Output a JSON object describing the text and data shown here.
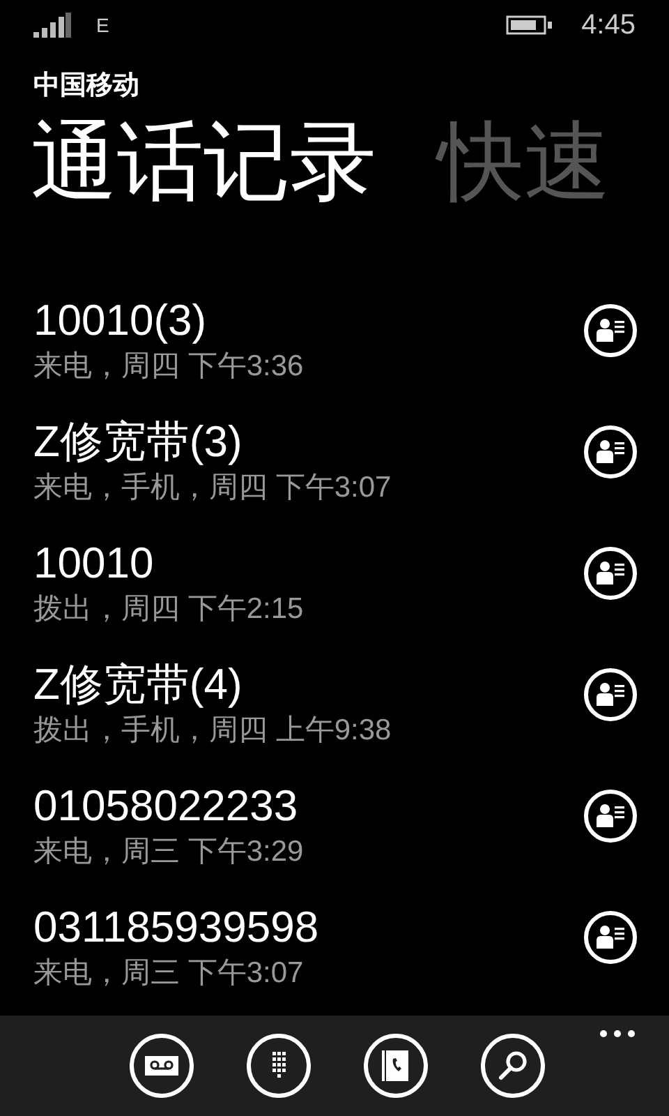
{
  "status_bar": {
    "network": "E",
    "time": "4:45"
  },
  "carrier": "中国移动",
  "pivots": [
    {
      "label": "通话记录",
      "selected": true
    },
    {
      "label": "快速",
      "selected": false
    }
  ],
  "calls": [
    {
      "name": "10010(3)",
      "detail": "来电，周四 下午3:36"
    },
    {
      "name": "Z修宽带(3)",
      "detail": "来电，手机，周四 下午3:07"
    },
    {
      "name": "10010",
      "detail": "拨出，周四 下午2:15"
    },
    {
      "name": "Z修宽带(4)",
      "detail": "拨出，手机，周四 上午9:38"
    },
    {
      "name": "01058022233",
      "detail": "来电，周三 下午3:29"
    },
    {
      "name": "031185939598",
      "detail": "来电，周三 下午3:07"
    }
  ],
  "app_bar": {
    "buttons": [
      {
        "kind": "voicemail"
      },
      {
        "kind": "keypad"
      },
      {
        "kind": "contacts"
      },
      {
        "kind": "search"
      }
    ]
  }
}
